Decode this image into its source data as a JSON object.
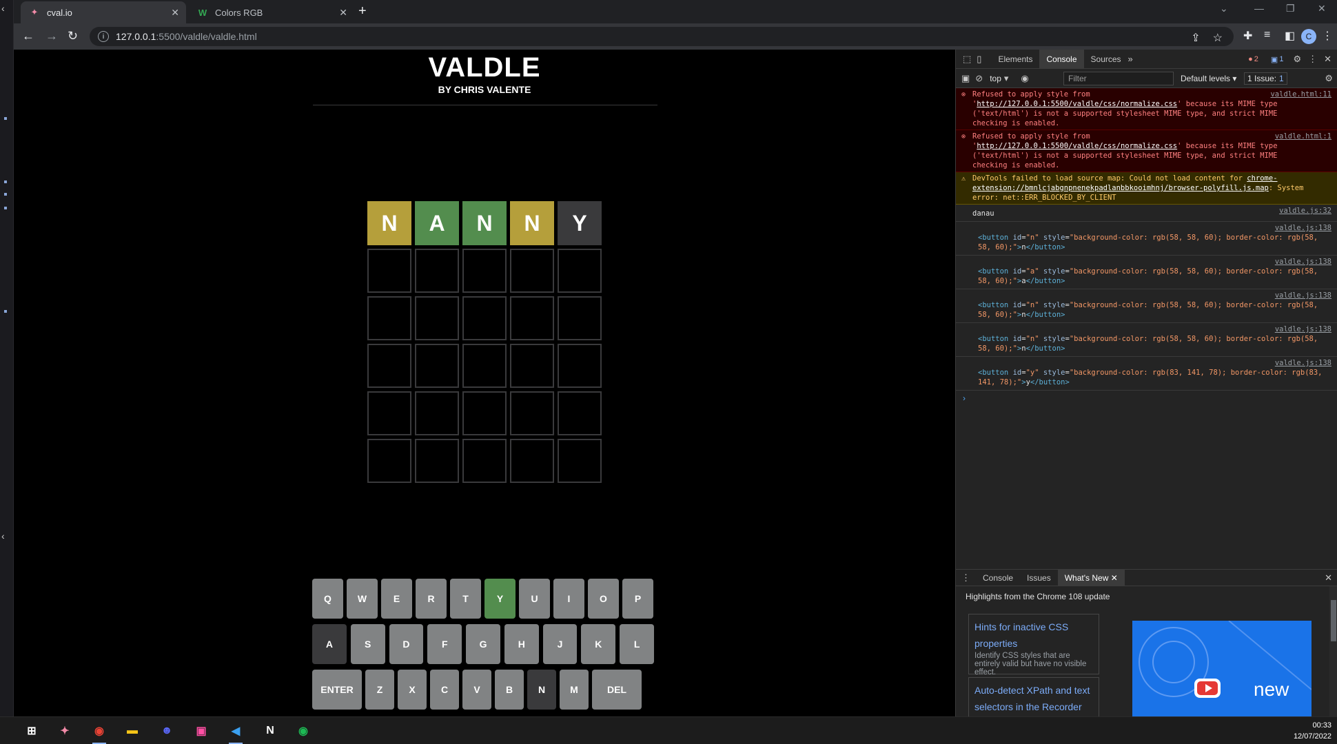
{
  "browser": {
    "tabs": [
      {
        "title": "cval.io",
        "active": true
      },
      {
        "title": "Colors RGB",
        "active": false
      }
    ],
    "url_host": "127.0.0.1",
    "url_path": ":5500/valdle/valdle.html",
    "profile_initial": "C"
  },
  "game": {
    "title": "VALDLE",
    "subtitle": "BY CHRIS VALENTE",
    "colors": {
      "green": "#538d4e",
      "yellow": "#b59f3b",
      "gray": "#3a3a3c",
      "key_default": "#818384"
    },
    "rows": [
      [
        {
          "letter": "N",
          "state": "yellow"
        },
        {
          "letter": "A",
          "state": "green"
        },
        {
          "letter": "N",
          "state": "green"
        },
        {
          "letter": "N",
          "state": "yellow"
        },
        {
          "letter": "Y",
          "state": "gray"
        }
      ],
      [],
      [],
      [],
      [],
      []
    ],
    "keyboard": [
      [
        {
          "k": "Q"
        },
        {
          "k": "W"
        },
        {
          "k": "E"
        },
        {
          "k": "R"
        },
        {
          "k": "T"
        },
        {
          "k": "Y",
          "state": "green"
        },
        {
          "k": "U"
        },
        {
          "k": "I"
        },
        {
          "k": "O"
        },
        {
          "k": "P"
        }
      ],
      [
        {
          "k": "A",
          "state": "gray"
        },
        {
          "k": "S"
        },
        {
          "k": "D"
        },
        {
          "k": "F"
        },
        {
          "k": "G"
        },
        {
          "k": "H"
        },
        {
          "k": "J"
        },
        {
          "k": "K"
        },
        {
          "k": "L"
        }
      ],
      [
        {
          "k": "ENTER",
          "wide": true
        },
        {
          "k": "Z"
        },
        {
          "k": "X"
        },
        {
          "k": "C"
        },
        {
          "k": "V"
        },
        {
          "k": "B"
        },
        {
          "k": "N",
          "state": "gray"
        },
        {
          "k": "M"
        },
        {
          "k": "DEL",
          "wide": true
        }
      ]
    ]
  },
  "devtools": {
    "tabs": [
      "Elements",
      "Console",
      "Sources"
    ],
    "active_tab": "Console",
    "errors_count": "2",
    "messages_count": "1",
    "context": "top",
    "filter_placeholder": "Filter",
    "levels": "Default levels",
    "issues_label": "1 Issue:",
    "issues_count": "1",
    "messages": [
      {
        "type": "error",
        "pre": "Refused to apply style from '",
        "link": "http://127.0.0.1:5500/valdle/css/normalize.css",
        "post": "' because its MIME type ('text/html') is not a supported stylesheet MIME type, and strict MIME checking is enabled.",
        "src": "valdle.html:11"
      },
      {
        "type": "error",
        "pre": "Refused to apply style from '",
        "link": "http://127.0.0.1:5500/valdle/css/normalize.css",
        "post": "' because its MIME type ('text/html') is not a supported stylesheet MIME type, and strict MIME checking is enabled.",
        "src": "valdle.html:1"
      },
      {
        "type": "warn",
        "pre": "DevTools failed to load source map: Could not load content for ",
        "link": "chrome-extension://bmnlcjabgnpnenekpadlanbbkooimhnj/browser-polyfill.js.map",
        "post": ": System error: net::ERR_BLOCKED_BY_CLIENT",
        "src": ""
      },
      {
        "type": "log",
        "text": "danau",
        "src": "valdle.js:32"
      }
    ],
    "button_logs": [
      {
        "id": "n",
        "bg": "rgb(58, 58, 60)",
        "border": "rgb(58, 58, 60)",
        "text": "n",
        "src": "valdle.js:138"
      },
      {
        "id": "a",
        "bg": "rgb(58, 58, 60)",
        "border": "rgb(58, 58, 60)",
        "text": "a",
        "src": "valdle.js:138"
      },
      {
        "id": "n",
        "bg": "rgb(58, 58, 60)",
        "border": "rgb(58, 58, 60)",
        "text": "n",
        "src": "valdle.js:138"
      },
      {
        "id": "n",
        "bg": "rgb(58, 58, 60)",
        "border": "rgb(58, 58, 60)",
        "text": "n",
        "src": "valdle.js:138"
      },
      {
        "id": "y",
        "bg": "rgb(83, 141, 78)",
        "border": "rgb(83, 141, 78)",
        "text": "y",
        "src": "valdle.js:138"
      }
    ],
    "drawer": {
      "tabs": [
        "Console",
        "Issues",
        "What's New"
      ],
      "active": "What's New",
      "heading": "Highlights from the Chrome 108 update",
      "cards": [
        {
          "title": "Hints for inactive CSS properties",
          "desc": "Identify CSS styles that are entirely valid but have no visible effect."
        },
        {
          "title": "Auto-detect XPath and text selectors in the Recorder",
          "desc": ""
        }
      ],
      "image_text": "new"
    }
  },
  "taskbar": {
    "time": "00:33",
    "date": "12/07/2022"
  }
}
